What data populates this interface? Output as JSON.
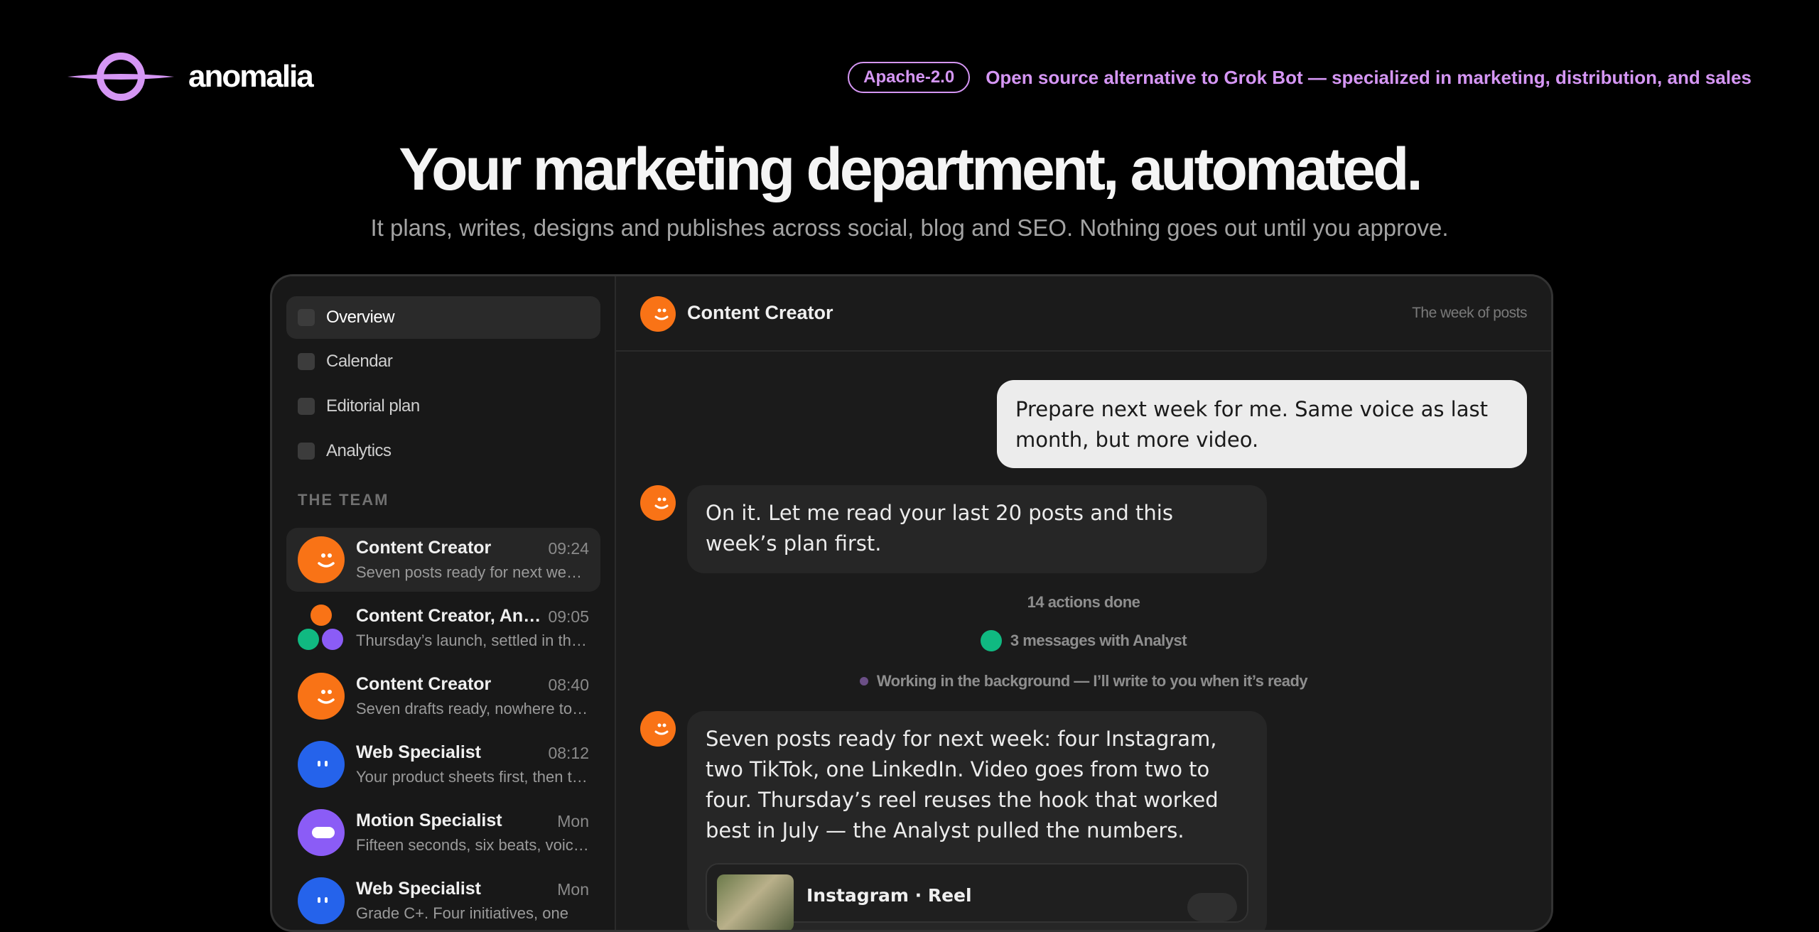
{
  "brand": {
    "name": "anomalia",
    "accent": "#d596f4"
  },
  "topbar": {
    "license": "Apache-2.0",
    "tagline": "Open source alternative to Grok Bot — specialized in marketing, distribution, and sales"
  },
  "hero": {
    "headline": "Your marketing department, automated.",
    "subline": "It plans, writes, designs and publishes across social, blog and SEO. Nothing goes out until you approve."
  },
  "sidebar": {
    "nav": [
      {
        "label": "Overview",
        "active": true
      },
      {
        "label": "Calendar"
      },
      {
        "label": "Editorial plan"
      },
      {
        "label": "Analytics"
      }
    ],
    "section_label": "THE TEAM",
    "conversations": [
      {
        "name": "Content Creator",
        "time": "09:24",
        "preview": "Seven posts ready for next week: four Instagram",
        "avatar": "orange-smile-icon",
        "active": true
      },
      {
        "name": "Content Creator, Analyst, Motion Specialist",
        "time": "09:05",
        "preview": "Thursday’s launch, settled in three messages",
        "avatar": "group-avatar-icon"
      },
      {
        "name": "Content Creator",
        "time": "08:40",
        "preview": "Seven drafts ready, nowhere to publish them",
        "avatar": "orange-smile-icon"
      },
      {
        "name": "Web Specialist",
        "time": "08:12",
        "preview": "Your product sheets first, then the blog",
        "avatar": "blue-eyes-icon"
      },
      {
        "name": "Motion Specialist",
        "time": "Mon",
        "preview": "Fifteen seconds, six beats, voice-over",
        "avatar": "purple-pill-icon"
      },
      {
        "name": "Web Specialist",
        "time": "Mon",
        "preview": "Grade C+. Four initiatives, one",
        "avatar": "blue-eyes-icon"
      }
    ]
  },
  "chat": {
    "title": "Content Creator",
    "meta": "The week of posts",
    "messages": {
      "user_1": "Prepare next week for me. Same voice as last month, but more video.",
      "ai_1": "On it. Let me read your last 20 posts and this week’s plan first.",
      "status_actions": "14 actions done",
      "status_messages": "3 messages with Analyst",
      "status_background": "Working in the background — I’ll write to you when it’s ready",
      "ai_2": "Seven posts ready for next week: four Instagram, two TikTok, one LinkedIn. Video goes from two to four. Thursday’s reel reuses the hook that worked best in July — the Analyst pulled the numbers."
    },
    "attachment": {
      "title": "Instagram · Reel"
    }
  },
  "colors": {
    "orange": "#f97316",
    "blue": "#2563eb",
    "purple": "#8b5cf6",
    "green": "#10b981"
  }
}
